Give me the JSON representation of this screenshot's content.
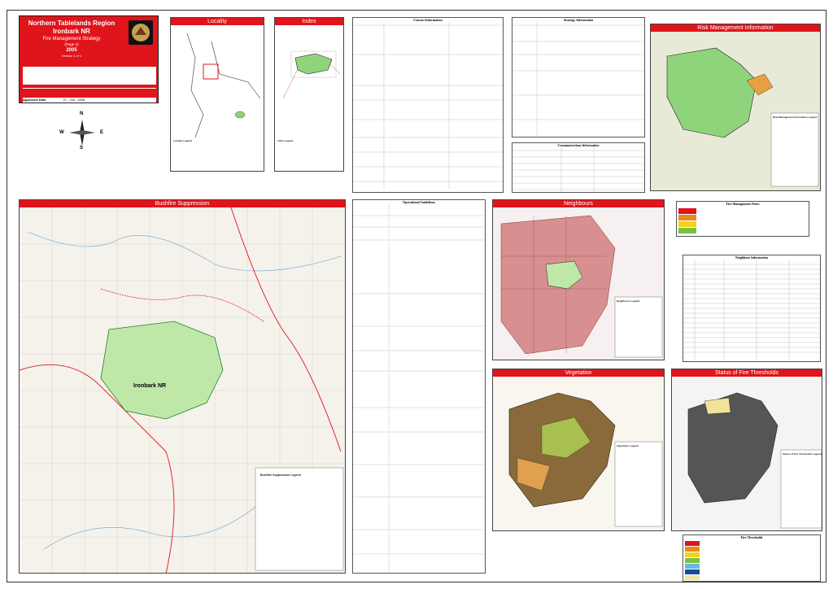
{
  "title_block": {
    "region": "Northern Tablelands Region",
    "reserve": "Ironbark NR",
    "strategy": "Fire Management Strategy",
    "page": "(Page 2)",
    "year": "2005",
    "version": "Version 1 of 1",
    "approval_label": "Approved Date",
    "approval_date": "27 - Oct - 2005"
  },
  "panels": {
    "locality": "Locality",
    "index": "Index",
    "risk": "Risk Management Information",
    "bushfire": "Bushfire Suppression",
    "neighbours": "Neighbours",
    "vegetation": "Vegetation",
    "thresholds": "Status of Fire Thresholds"
  },
  "map_labels": {
    "reserve_name": "Ironbark NR",
    "north": "N",
    "south": "S",
    "east": "E",
    "west": "W"
  },
  "tables": {
    "contact": "Contact Information",
    "strategy": "Strategy Information",
    "communications": "Communications Information",
    "operational": "Operational Guidelines",
    "management": "Fire Management Notes",
    "neighbour_info": "Neighbour Information",
    "thresholds": "Fire Thresholds"
  },
  "legends": {
    "locality": "Locality Legend",
    "index": "Index Legend",
    "risk": "Risk Management Information Legend",
    "neighbours": "Neighbours Legend",
    "vegetation": "Vegetation Legend",
    "thresholds": "Status of Fire Thresholds Legend",
    "suppression": "Bushfire Suppression Legend"
  },
  "colors": {
    "banner": "#e0141b",
    "reserve_green": "#8fd47a",
    "neighbour_pink": "#d88f8f",
    "threshold_grey": "#555555",
    "veg_brown": "#8a6a3a"
  }
}
